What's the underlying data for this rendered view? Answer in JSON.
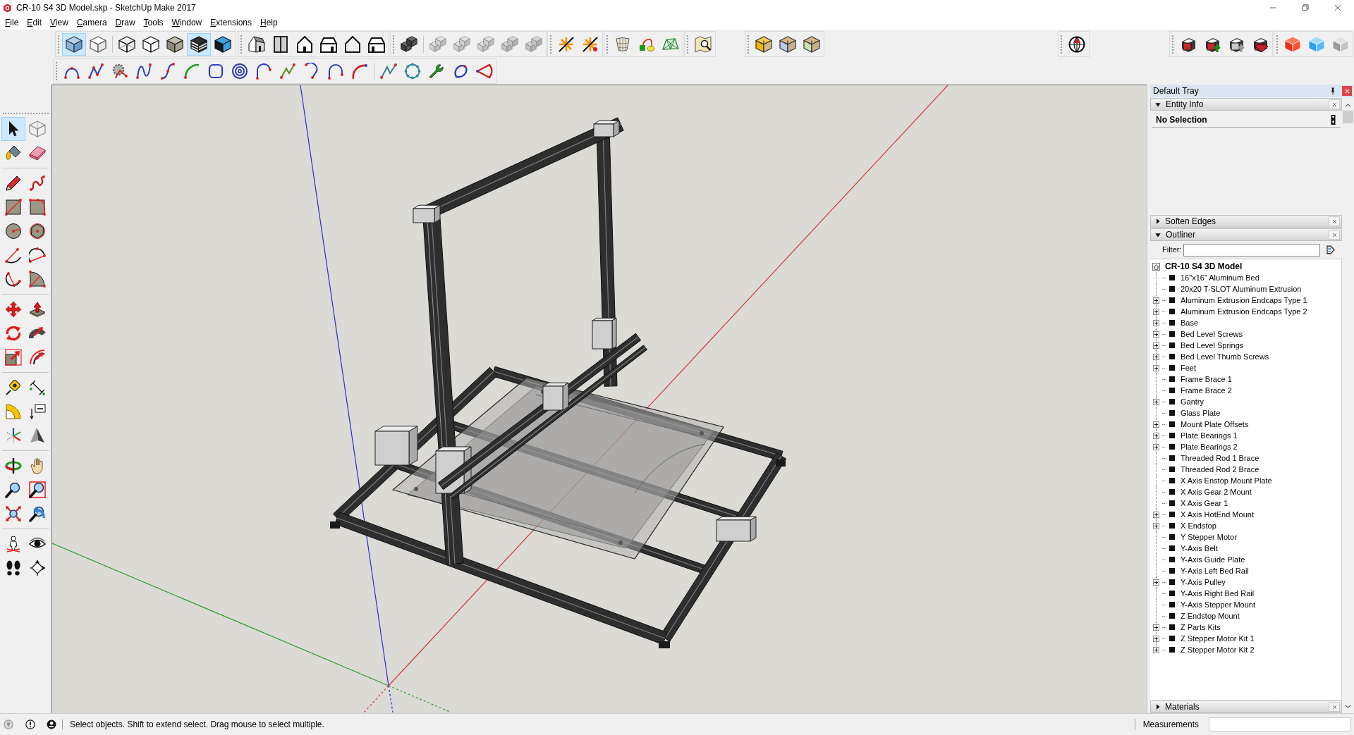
{
  "window": {
    "title": "CR-10 S4 3D Model.skp - SketchUp Make 2017"
  },
  "menu": [
    "File",
    "Edit",
    "View",
    "Camera",
    "Draw",
    "Tools",
    "Window",
    "Extensions",
    "Help"
  ],
  "top_toolbars": [
    {
      "sections": [
        [
          {
            "selected": true
          },
          {
            "selected": false
          }
        ],
        [
          {
            "selected": false
          },
          {
            "selected": false
          },
          {
            "selected": false
          },
          {
            "selected": true
          },
          {
            "selected": false
          }
        ]
      ]
    },
    {
      "sections": [
        [
          {
            "selected": false
          },
          {
            "selected": false
          },
          {
            "selected": false
          },
          {
            "selected": false
          },
          {
            "selected": false
          },
          {
            "selected": false
          }
        ]
      ]
    },
    {
      "sections": [
        [
          {
            "selected": false
          }
        ],
        [
          {
            "selected": false
          },
          {
            "selected": false
          },
          {
            "selected": false
          },
          {
            "selected": false
          },
          {
            "selected": false
          }
        ]
      ]
    },
    {
      "sections": [
        [
          {
            "selected": false
          },
          {
            "selected": false
          }
        ]
      ]
    },
    {
      "sections": [
        [
          {
            "selected": false
          },
          {
            "selected": false
          },
          {
            "selected": false
          }
        ]
      ]
    },
    {
      "sections": [
        [
          {
            "selected": false
          }
        ]
      ]
    },
    {
      "sections": [
        [
          {
            "selected": false
          },
          {
            "selected": false
          },
          {
            "selected": false
          }
        ]
      ]
    },
    {
      "sections": [
        [
          {
            "selected": false
          }
        ]
      ]
    },
    {
      "sections": [
        [
          {
            "selected": false
          },
          {
            "selected": false
          },
          {
            "selected": false
          },
          {
            "selected": false
          }
        ]
      ]
    },
    {
      "sections": [
        [
          {
            "selected": false
          },
          {
            "selected": false
          },
          {
            "selected": false
          }
        ]
      ]
    }
  ],
  "curve_toolbars": [
    {
      "sections": [
        [
          {
            "selected": false
          },
          {
            "selected": false
          },
          {
            "selected": false
          },
          {
            "selected": false
          },
          {
            "selected": false
          },
          {
            "selected": false
          },
          {
            "selected": false
          },
          {
            "selected": false
          },
          {
            "selected": false
          },
          {
            "selected": false
          },
          {
            "selected": false
          },
          {
            "selected": false
          },
          {
            "selected": false
          }
        ],
        [
          {
            "selected": false
          },
          {
            "selected": false
          },
          {
            "selected": false
          },
          {
            "selected": false
          },
          {
            "selected": false
          }
        ]
      ]
    }
  ],
  "tool_palette": {
    "sections": [
      [
        {
          "selected": true
        },
        {
          "selected": false
        },
        {
          "selected": false
        },
        {
          "selected": false
        }
      ],
      [
        {
          "selected": false
        },
        {
          "selected": false
        },
        {
          "selected": false
        },
        {
          "selected": false
        },
        {
          "selected": false
        },
        {
          "selected": false
        },
        {
          "selected": false
        },
        {
          "selected": false
        },
        {
          "selected": false
        },
        {
          "selected": false
        }
      ],
      [
        {
          "selected": false
        },
        {
          "selected": false
        },
        {
          "selected": false
        },
        {
          "selected": false
        },
        {
          "selected": false
        },
        {
          "selected": false
        }
      ],
      [
        {
          "selected": false
        },
        {
          "selected": false
        },
        {
          "selected": false
        },
        {
          "selected": false
        },
        {
          "selected": false
        },
        {
          "selected": false
        }
      ],
      [
        {
          "selected": false
        },
        {
          "selected": false
        },
        {
          "selected": false
        },
        {
          "selected": false
        },
        {
          "selected": false
        },
        {
          "selected": false
        }
      ],
      [
        {
          "selected": false
        },
        {
          "selected": false
        },
        {
          "selected": false
        },
        {
          "selected": false
        }
      ]
    ]
  },
  "tray": {
    "title": "Default Tray",
    "panels": [
      {
        "kind": "entity_info",
        "title": "Entity Info",
        "expanded": true,
        "selection": "No Selection"
      },
      {
        "kind": "plain",
        "title": "Soften Edges",
        "expanded": false
      },
      {
        "kind": "outliner",
        "title": "Outliner",
        "expanded": true,
        "filter_label": "Filter:",
        "root": {
          "label": "CR-10 S4 3D Model",
          "children": [
            {
              "label": "16\"x16\" Aluminum Bed",
              "expandable": false
            },
            {
              "label": "20x20 T-SLOT Aluminum Extrusion",
              "expandable": false
            },
            {
              "label": "Aluminum Extrusion Endcaps Type 1",
              "expandable": true
            },
            {
              "label": "Aluminum Extrusion Endcaps Type 2",
              "expandable": true
            },
            {
              "label": "Base",
              "expandable": true
            },
            {
              "label": "Bed Level Screws",
              "expandable": true
            },
            {
              "label": "Bed Level Springs",
              "expandable": true
            },
            {
              "label": "Bed Level Thumb Screws",
              "expandable": true
            },
            {
              "label": "Feet",
              "expandable": true
            },
            {
              "label": "Frame Brace 1",
              "expandable": false
            },
            {
              "label": "Frame Brace 2",
              "expandable": false
            },
            {
              "label": "Gantry",
              "expandable": true
            },
            {
              "label": "Glass Plate",
              "expandable": false
            },
            {
              "label": "Mount Plate Offsets",
              "expandable": true
            },
            {
              "label": "Plate Bearings 1",
              "expandable": true
            },
            {
              "label": "Plate Bearings 2",
              "expandable": true
            },
            {
              "label": "Threaded Rod 1 Brace",
              "expandable": false
            },
            {
              "label": "Threaded Rod 2 Brace",
              "expandable": false
            },
            {
              "label": "X Axis Enstop Mount Plate",
              "expandable": false
            },
            {
              "label": "X Axis Gear 2 Mount",
              "expandable": false
            },
            {
              "label": "X Axis Gear 1",
              "expandable": false
            },
            {
              "label": "X Axis HotEnd Mount",
              "expandable": true
            },
            {
              "label": "X Endstop",
              "expandable": true
            },
            {
              "label": "Y Stepper Motor",
              "expandable": false
            },
            {
              "label": "Y-Axis Belt",
              "expandable": false
            },
            {
              "label": "Y-Axis Guide Plate",
              "expandable": false
            },
            {
              "label": "Y-Axis Left Bed Rail",
              "expandable": false
            },
            {
              "label": "Y-Axis Pulley",
              "expandable": true
            },
            {
              "label": "Y-Axis Right Bed Rail",
              "expandable": false
            },
            {
              "label": "Y-Axis Stepper Mount",
              "expandable": false
            },
            {
              "label": "Z Endstop Mount",
              "expandable": false
            },
            {
              "label": "Z Parts Kits",
              "expandable": true
            },
            {
              "label": "Z Stepper Motor Kit 1",
              "expandable": true
            },
            {
              "label": "Z Stepper Motor Kit 2",
              "expandable": true
            }
          ]
        }
      },
      {
        "kind": "plain",
        "title": "Materials",
        "expanded": false
      }
    ]
  },
  "status_bar": {
    "hint": "Select objects. Shift to extend select. Drag mouse to select multiple.",
    "measurements_label": "Measurements"
  }
}
